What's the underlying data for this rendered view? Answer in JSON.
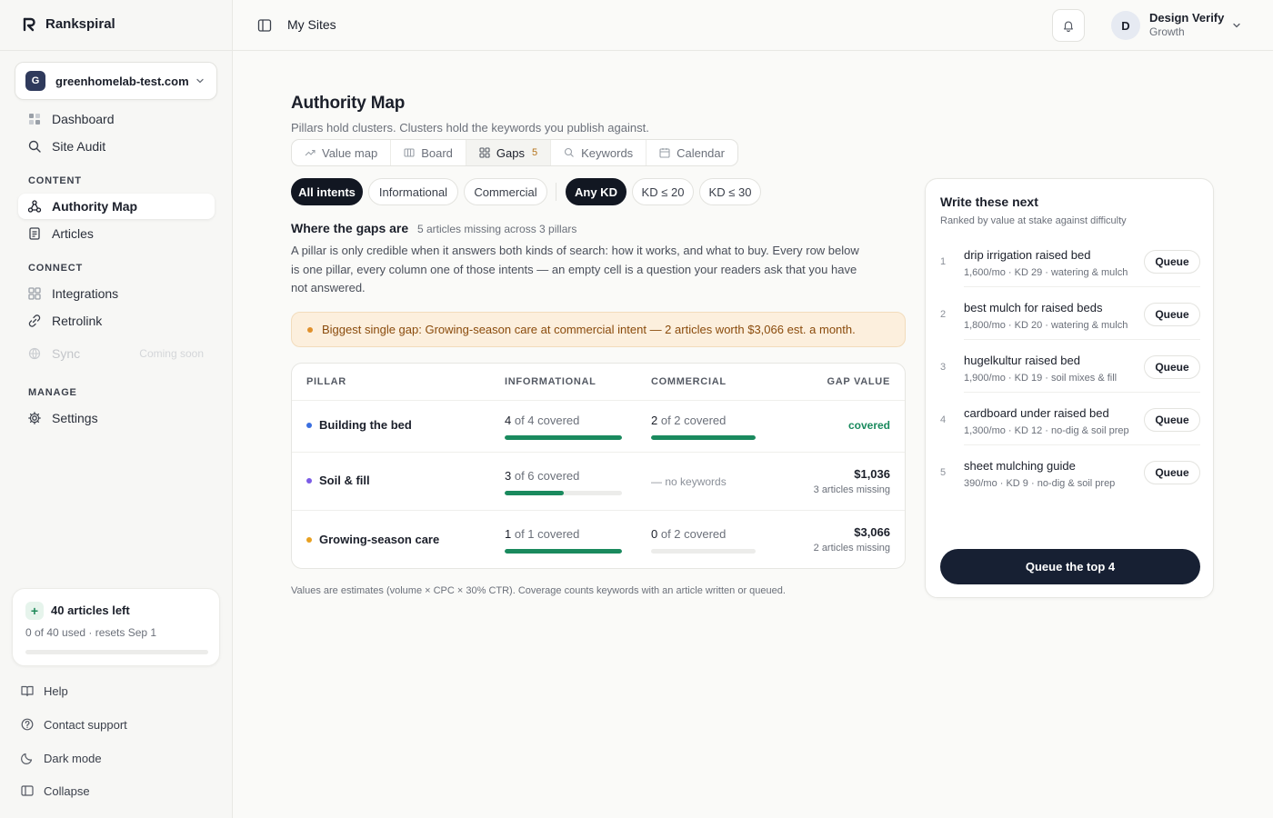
{
  "brand": {
    "name": "Rankspiral"
  },
  "site": {
    "initial": "G",
    "name": "greenhomelab-test.com"
  },
  "nav": {
    "dashboard": "Dashboard",
    "site_audit": "Site Audit",
    "content_label": "CONTENT",
    "authority_map": "Authority Map",
    "articles": "Articles",
    "connect_label": "CONNECT",
    "integrations": "Integrations",
    "retrolink": "Retrolink",
    "sync": "Sync",
    "sync_badge": "Coming soon",
    "manage_label": "MANAGE",
    "settings": "Settings"
  },
  "credits": {
    "title": "40 articles left",
    "sub": "0 of 40 used · resets Sep 1",
    "used_fraction": 0
  },
  "footer": {
    "help": "Help",
    "contact": "Contact support",
    "dark_mode": "Dark mode",
    "collapse": "Collapse"
  },
  "topbar": {
    "breadcrumb": "My Sites",
    "user_initial": "D",
    "user_name": "Design Verify",
    "user_plan": "Growth"
  },
  "page": {
    "title": "Authority Map",
    "subtitle": "Pillars hold clusters. Clusters hold the keywords you publish against."
  },
  "tabs": [
    {
      "label": "Value map",
      "icon": "trend-icon"
    },
    {
      "label": "Board",
      "icon": "board-icon"
    },
    {
      "label": "Gaps",
      "icon": "grid-icon",
      "count": "5"
    },
    {
      "label": "Keywords",
      "icon": "search-icon"
    },
    {
      "label": "Calendar",
      "icon": "calendar-icon"
    }
  ],
  "filters": {
    "intent": [
      "All intents",
      "Informational",
      "Commercial"
    ],
    "kd": [
      "Any KD",
      "KD ≤ 20",
      "KD ≤ 30"
    ]
  },
  "gaps": {
    "heading": "Where the gaps are",
    "meta": "5 articles missing across 3 pillars",
    "description": "A pillar is only credible when it answers both kinds of search: how it works, and what to buy. Every row below is one pillar, every column one of those intents — an empty cell is a question your readers ask that you have not answered.",
    "callout": "Biggest single gap: Growing-season care at commercial intent — 2 articles worth $3,066 est. a month."
  },
  "table": {
    "headers": {
      "pillar": "PILLAR",
      "informational": "INFORMATIONAL",
      "commercial": "COMMERCIAL",
      "gap_value": "GAP VALUE"
    },
    "rows": [
      {
        "pillar": "Building the bed",
        "dot_color": "#3b6fe0",
        "info_num": "4",
        "info_rest": " of 4 covered",
        "info_fraction": 1.0,
        "comm_num": "2",
        "comm_rest": " of 2 covered",
        "comm_fraction": 1.0,
        "gap_value": "covered"
      },
      {
        "pillar": "Soil & fill",
        "dot_color": "#7b5ce6",
        "info_num": "3",
        "info_rest": " of 6 covered",
        "info_fraction": 0.5,
        "comm_none": "— no keywords",
        "gap_value": "$1,036",
        "gap_missing": "3 articles missing"
      },
      {
        "pillar": "Growing-season care",
        "dot_color": "#e8a020",
        "info_num": "1",
        "info_rest": " of 1 covered",
        "info_fraction": 1.0,
        "comm_num": "0",
        "comm_rest": " of 2 covered",
        "comm_fraction": 0,
        "gap_value": "$3,066",
        "gap_missing": "2 articles missing"
      }
    ]
  },
  "footnote": "Values are estimates (volume × CPC × 30% CTR). Coverage counts keywords with an article written or queued.",
  "next": {
    "title": "Write these next",
    "subtitle": "Ranked by value at stake against difficulty",
    "items": [
      {
        "num": "1",
        "keyword": "drip irrigation raised bed",
        "meta": "1,600/mo · KD 29 · watering & mulch",
        "action": "Queue"
      },
      {
        "num": "2",
        "keyword": "best mulch for raised beds",
        "meta": "1,800/mo · KD 20 · watering & mulch",
        "action": "Queue"
      },
      {
        "num": "3",
        "keyword": "hugelkultur raised bed",
        "meta": "1,900/mo · KD 19 · soil mixes & fill",
        "action": "Queue"
      },
      {
        "num": "4",
        "keyword": "cardboard under raised bed",
        "meta": "1,300/mo · KD 12 · no-dig & soil prep",
        "action": "Queue"
      },
      {
        "num": "5",
        "keyword": "sheet mulching guide",
        "meta": "390/mo · KD 9 · no-dig & soil prep",
        "action": "Queue"
      }
    ],
    "cta": "Queue the top 4"
  }
}
